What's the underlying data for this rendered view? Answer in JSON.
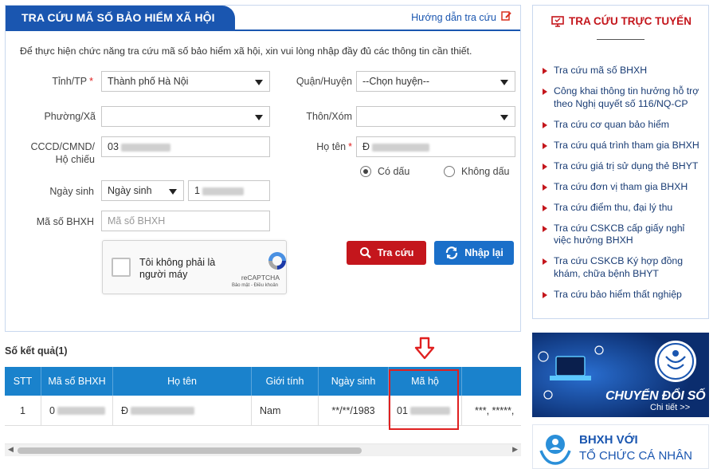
{
  "header": {
    "title": "TRA CỨU MÃ SỐ BẢO HIỂM XÃ HỘI",
    "help_link": "Hướng dẫn tra cứu"
  },
  "intro": "Để thực hiện chức năng tra cứu mã số bảo hiểm xã hội, xin vui lòng nhập đầy đủ các thông tin cần thiết.",
  "form": {
    "province_label": "Tỉnh/TP",
    "province_value": "Thành phố Hà Nội",
    "district_label": "Quận/Huyện",
    "district_value": "--Chọn huyện--",
    "ward_label": "Phường/Xã",
    "ward_value": "",
    "village_label": "Thôn/Xóm",
    "village_value": "",
    "id_label_1": "CCCD/CMND/",
    "id_label_2": "Hộ chiếu",
    "id_value_prefix": "03",
    "name_label": "Họ tên",
    "name_value_prefix": "Đ",
    "radio_accent": "Có dấu",
    "radio_no_accent": "Không dấu",
    "dob_label": "Ngày sinh",
    "dob_type": "Ngày sinh",
    "dob_value_prefix": "1",
    "bhxh_label": "Mã số BHXH",
    "bhxh_placeholder": "Mã số BHXH",
    "required_mark": "*"
  },
  "captcha": {
    "text": "Tôi không phải là người máy",
    "brand": "reCAPTCHA",
    "links": "Bảo mật - Điều khoản"
  },
  "buttons": {
    "search": "Tra cứu",
    "reset": "Nhập lại"
  },
  "results": {
    "title": "Số kết quả(1)",
    "columns": [
      "STT",
      "Mã số BHXH",
      "Họ tên",
      "Giới tính",
      "Ngày sinh",
      "Mã hộ"
    ],
    "row": {
      "stt": "1",
      "bhxh_prefix": "0",
      "name_prefix": "Đ",
      "gender": "Nam",
      "dob": "**/**/1983",
      "household_prefix": "01",
      "overflow": "***, *****,"
    }
  },
  "sidebar": {
    "title": "TRA CỨU TRỰC TUYẾN",
    "items": [
      "Tra cứu mã số BHXH",
      "Công khai thông tin hưởng hỗ trợ theo Nghị quyết số 116/NQ-CP",
      "Tra cứu cơ quan bảo hiểm",
      "Tra cứu quá trình tham gia BHXH",
      "Tra cứu giá trị sử dụng thẻ BHYT",
      "Tra cứu đơn vị tham gia BHXH",
      "Tra cứu điểm thu, đại lý thu",
      "Tra cứu CSKCB cấp giấy nghỉ việc hưởng BHXH",
      "Tra cứu CSKCB Ký hợp đồng khám, chữa bệnh BHYT",
      "Tra cứu bảo hiểm thất nghiệp"
    ]
  },
  "banners": {
    "digital_title": "CHUYỂN ĐỔI SỐ",
    "digital_more": "Chi tiết >>",
    "org_line1": "BHXH VỚI",
    "org_line2": "TỔ CHỨC CÁ NHÂN"
  },
  "colors": {
    "primary": "#1a56b0",
    "danger": "#c4161c",
    "table_header": "#1a82cc",
    "highlight": "#e02020"
  }
}
